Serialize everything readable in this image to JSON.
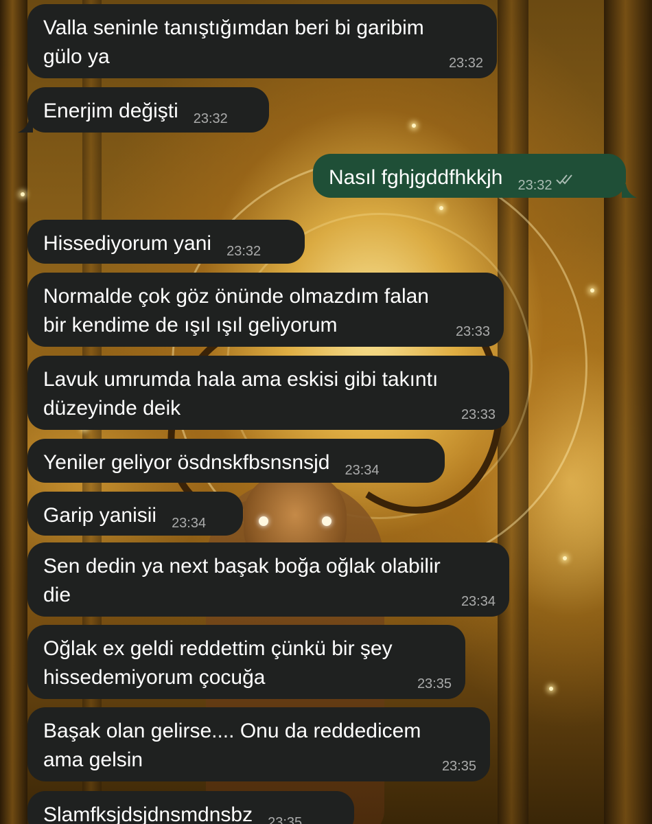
{
  "wallpaper": {
    "description_icon": "golden-stag-forest-wallpaper"
  },
  "colors": {
    "incoming_bubble": "#1f2120",
    "outgoing_bubble": "#1f4f37",
    "text": "#ffffff",
    "timestamp": "#a6a6a6"
  },
  "messages": [
    {
      "direction": "in",
      "text": "Valla seninle tanıştığımdan beri bi garibim\ngülo ya",
      "time": "23:32"
    },
    {
      "direction": "in",
      "text": "Enerjim değişti",
      "time": "23:32"
    },
    {
      "direction": "out",
      "text": "Nasıl fghjgddfhkkjh",
      "time": "23:32",
      "status": "read-double-check-icon"
    },
    {
      "direction": "in",
      "text": "Hissediyorum yani",
      "time": "23:32"
    },
    {
      "direction": "in",
      "text": "Normalde çok göz önünde olmazdım falan\nbir kendime de ışıl ışıl geliyorum",
      "time": "23:33"
    },
    {
      "direction": "in",
      "text": "Lavuk umrumda hala ama eskisi gibi takıntı\ndüzeyinde deik",
      "time": "23:33"
    },
    {
      "direction": "in",
      "text": "Yeniler geliyor ösdnskfbsnsnsjd",
      "time": "23:34"
    },
    {
      "direction": "in",
      "text": "Garip yanisii",
      "time": "23:34"
    },
    {
      "direction": "in",
      "text": "Sen dedin ya next başak boğa oğlak olabilir\ndie",
      "time": "23:34"
    },
    {
      "direction": "in",
      "text": "Oğlak ex geldi reddettim çünkü bir şey\nhissedemiyorum çocuğa",
      "time": "23:35"
    },
    {
      "direction": "in",
      "text": "Başak olan gelirse.... Onu da reddedicem\nama gelsin",
      "time": "23:35"
    },
    {
      "direction": "in",
      "text": "Slamfksjdsjdnsmdnsbz",
      "time": "23:35"
    }
  ]
}
